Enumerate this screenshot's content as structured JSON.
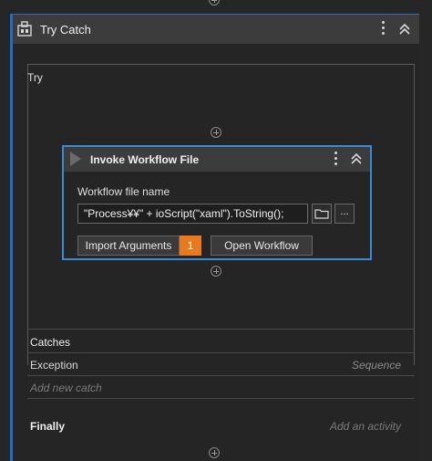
{
  "try_catch": {
    "title": "Try Catch",
    "try_label": "Try",
    "catches_label": "Catches",
    "exception_label": "Exception",
    "exception_handler": "Sequence",
    "add_catch_label": "Add new catch",
    "finally_label": "Finally",
    "add_activity_label": "Add an activity"
  },
  "invoke_workflow": {
    "title": "Invoke Workflow File",
    "file_label": "Workflow file name",
    "file_value": "\"Process¥¥\" + ioScript(\"xaml\").ToString();",
    "more_button_label": "...",
    "import_button_label": "Import Arguments",
    "import_count": "1",
    "open_button_label": "Open Workflow"
  },
  "colors": {
    "accent": "#1e6fc4",
    "selection_border": "#3a8ad6",
    "badge": "#e8791c"
  },
  "icons": {
    "try_catch": "try-catch-icon",
    "menu": "kebab-menu-icon",
    "collapse": "chevron-double-up-icon",
    "invoke": "play-icon",
    "folder": "folder-icon",
    "add": "plus-circle-icon"
  }
}
